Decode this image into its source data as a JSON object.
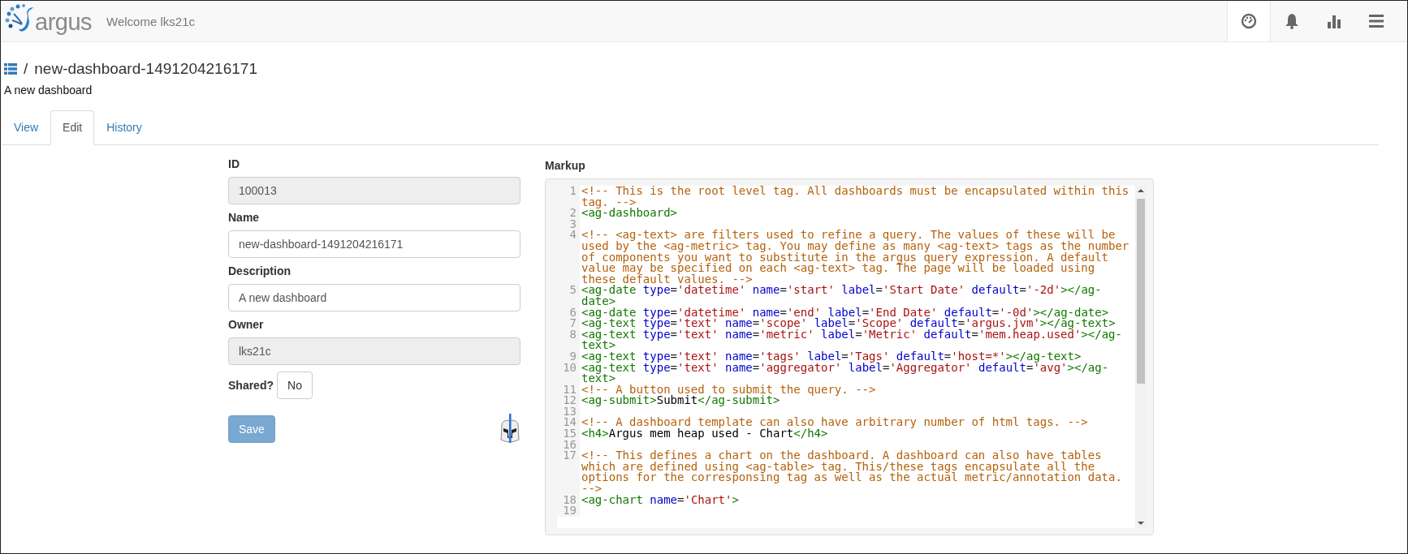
{
  "header": {
    "logo_text": "argus",
    "welcome": "Welcome lks21c",
    "nav_icons": [
      {
        "kind": "dashboard",
        "selected": true
      },
      {
        "kind": "bell",
        "selected": false
      },
      {
        "kind": "bars",
        "selected": false
      },
      {
        "kind": "menu",
        "selected": false
      }
    ]
  },
  "breadcrumb": {
    "separator": "/",
    "title": "new-dashboard-1491204216171"
  },
  "subtitle": "A new dashboard",
  "tabs": [
    {
      "label": "View",
      "selected": false
    },
    {
      "label": "Edit",
      "selected": true
    },
    {
      "label": "History",
      "selected": false
    }
  ],
  "form": {
    "fields": [
      {
        "label": "ID",
        "value": "100013",
        "readonly": true
      },
      {
        "label": "Name",
        "value": "new-dashboard-1491204216171",
        "readonly": false
      },
      {
        "label": "Description",
        "value": "A new dashboard",
        "readonly": false
      },
      {
        "label": "Owner",
        "value": "lks21c",
        "readonly": true
      }
    ],
    "shared": {
      "label": "Shared?",
      "value": "No"
    },
    "save": {
      "label": "Save",
      "disabled": true
    }
  },
  "markup": {
    "label": "Markup",
    "lines": [
      {
        "number": "1",
        "tokens": [
          {
            "kind": "comment",
            "text": "<!-- This is the root level tag. All dashboards must be encapsulated within this tag. -->"
          }
        ]
      },
      {
        "number": "2",
        "tokens": [
          {
            "kind": "tag",
            "text": "<ag-dashboard>"
          }
        ]
      },
      {
        "number": "3"
      },
      {
        "number": "4",
        "tokens": [
          {
            "kind": "comment",
            "text": "<!-- <ag-text> are filters used to refine a query. The values of these will be used by the <ag-metric> tag. You may define as many <ag-text> tags as the number of components you want to substitute in the argus query expression. A default value may be specified on each <ag-text> tag. The page will be loaded using these default values. -->"
          }
        ]
      },
      {
        "number": "5",
        "tokens": [
          {
            "kind": "tag",
            "text": "<ag-date"
          },
          {
            "kind": "attr",
            "text": " type"
          },
          {
            "kind": "punct",
            "text": "="
          },
          {
            "kind": "string",
            "text": "'datetime'"
          },
          {
            "kind": "attr",
            "text": " name"
          },
          {
            "kind": "punct",
            "text": "="
          },
          {
            "kind": "string",
            "text": "'start'"
          },
          {
            "kind": "attr",
            "text": " label"
          },
          {
            "kind": "punct",
            "text": "="
          },
          {
            "kind": "string",
            "text": "'Start Date'"
          },
          {
            "kind": "attr",
            "text": " default"
          },
          {
            "kind": "punct",
            "text": "="
          },
          {
            "kind": "string",
            "text": "'-2d'"
          },
          {
            "kind": "tag",
            "text": "></ag-date>"
          }
        ]
      },
      {
        "number": "6",
        "tokens": [
          {
            "kind": "tag",
            "text": "<ag-date"
          },
          {
            "kind": "attr",
            "text": " type"
          },
          {
            "kind": "punct",
            "text": "="
          },
          {
            "kind": "string",
            "text": "'datetime'"
          },
          {
            "kind": "attr",
            "text": " name"
          },
          {
            "kind": "punct",
            "text": "="
          },
          {
            "kind": "string",
            "text": "'end'"
          },
          {
            "kind": "attr",
            "text": " label"
          },
          {
            "kind": "punct",
            "text": "="
          },
          {
            "kind": "string",
            "text": "'End Date'"
          },
          {
            "kind": "attr",
            "text": " default"
          },
          {
            "kind": "punct",
            "text": "="
          },
          {
            "kind": "string",
            "text": "'-0d'"
          },
          {
            "kind": "tag",
            "text": "></ag-date>"
          }
        ]
      },
      {
        "number": "7",
        "tokens": [
          {
            "kind": "tag",
            "text": "<ag-text"
          },
          {
            "kind": "attr",
            "text": " type"
          },
          {
            "kind": "punct",
            "text": "="
          },
          {
            "kind": "string",
            "text": "'text'"
          },
          {
            "kind": "attr",
            "text": " name"
          },
          {
            "kind": "punct",
            "text": "="
          },
          {
            "kind": "string",
            "text": "'scope'"
          },
          {
            "kind": "attr",
            "text": " label"
          },
          {
            "kind": "punct",
            "text": "="
          },
          {
            "kind": "string",
            "text": "'Scope'"
          },
          {
            "kind": "attr",
            "text": " default"
          },
          {
            "kind": "punct",
            "text": "="
          },
          {
            "kind": "string",
            "text": "'argus.jvm'"
          },
          {
            "kind": "tag",
            "text": "></ag-text>"
          }
        ]
      },
      {
        "number": "8",
        "tokens": [
          {
            "kind": "tag",
            "text": "<ag-text"
          },
          {
            "kind": "attr",
            "text": " type"
          },
          {
            "kind": "punct",
            "text": "="
          },
          {
            "kind": "string",
            "text": "'text'"
          },
          {
            "kind": "attr",
            "text": " name"
          },
          {
            "kind": "punct",
            "text": "="
          },
          {
            "kind": "string",
            "text": "'metric'"
          },
          {
            "kind": "attr",
            "text": " label"
          },
          {
            "kind": "punct",
            "text": "="
          },
          {
            "kind": "string",
            "text": "'Metric'"
          },
          {
            "kind": "attr",
            "text": " default"
          },
          {
            "kind": "punct",
            "text": "="
          },
          {
            "kind": "string",
            "text": "'mem.heap.used'"
          },
          {
            "kind": "tag",
            "text": "></ag-text>"
          }
        ]
      },
      {
        "number": "9",
        "tokens": [
          {
            "kind": "tag",
            "text": "<ag-text"
          },
          {
            "kind": "attr",
            "text": " type"
          },
          {
            "kind": "punct",
            "text": "="
          },
          {
            "kind": "string",
            "text": "'text'"
          },
          {
            "kind": "attr",
            "text": " name"
          },
          {
            "kind": "punct",
            "text": "="
          },
          {
            "kind": "string",
            "text": "'tags'"
          },
          {
            "kind": "attr",
            "text": " label"
          },
          {
            "kind": "punct",
            "text": "="
          },
          {
            "kind": "string",
            "text": "'Tags'"
          },
          {
            "kind": "attr",
            "text": " default"
          },
          {
            "kind": "punct",
            "text": "="
          },
          {
            "kind": "string",
            "text": "'host=*'"
          },
          {
            "kind": "tag",
            "text": "></ag-text>"
          }
        ]
      },
      {
        "number": "10",
        "tokens": [
          {
            "kind": "tag",
            "text": "<ag-text"
          },
          {
            "kind": "attr",
            "text": " type"
          },
          {
            "kind": "punct",
            "text": "="
          },
          {
            "kind": "string",
            "text": "'text'"
          },
          {
            "kind": "attr",
            "text": " name"
          },
          {
            "kind": "punct",
            "text": "="
          },
          {
            "kind": "string",
            "text": "'aggregator'"
          },
          {
            "kind": "attr",
            "text": " label"
          },
          {
            "kind": "punct",
            "text": "="
          },
          {
            "kind": "string",
            "text": "'Aggregator'"
          },
          {
            "kind": "attr",
            "text": " default"
          },
          {
            "kind": "punct",
            "text": "="
          },
          {
            "kind": "string",
            "text": "'avg'"
          },
          {
            "kind": "tag",
            "text": "></ag-text>"
          }
        ]
      },
      {
        "number": "11",
        "tokens": [
          {
            "kind": "comment",
            "text": "<!-- A button used to submit the query. -->"
          }
        ]
      },
      {
        "number": "12",
        "tokens": [
          {
            "kind": "tag",
            "text": "<ag-submit>"
          },
          {
            "kind": "text",
            "text": "Submit"
          },
          {
            "kind": "tag",
            "text": "</ag-submit>"
          }
        ]
      },
      {
        "number": "13"
      },
      {
        "number": "14",
        "tokens": [
          {
            "kind": "comment",
            "text": "<!-- A dashboard template can also have arbitrary number of html tags. -->"
          }
        ]
      },
      {
        "number": "15",
        "tokens": [
          {
            "kind": "tag",
            "text": "<h4>"
          },
          {
            "kind": "text",
            "text": "Argus mem heap used - Chart"
          },
          {
            "kind": "tag",
            "text": "</h4>"
          }
        ]
      },
      {
        "number": "16"
      },
      {
        "number": "17",
        "tokens": [
          {
            "kind": "comment",
            "text": "<!-- This defines a chart on the dashboard. A dashboard can also have tables which are defined using <ag-table> tag. This/these tags encapsulate all the options for the corresponsing tag as well as the actual metric/annotation data. -->"
          }
        ]
      },
      {
        "number": "18",
        "tokens": [
          {
            "kind": "tag",
            "text": "<ag-chart"
          },
          {
            "kind": "attr",
            "text": " name"
          },
          {
            "kind": "punct",
            "text": "="
          },
          {
            "kind": "string",
            "text": "'Chart'"
          },
          {
            "kind": "tag",
            "text": ">"
          }
        ]
      },
      {
        "number": "19"
      }
    ]
  }
}
